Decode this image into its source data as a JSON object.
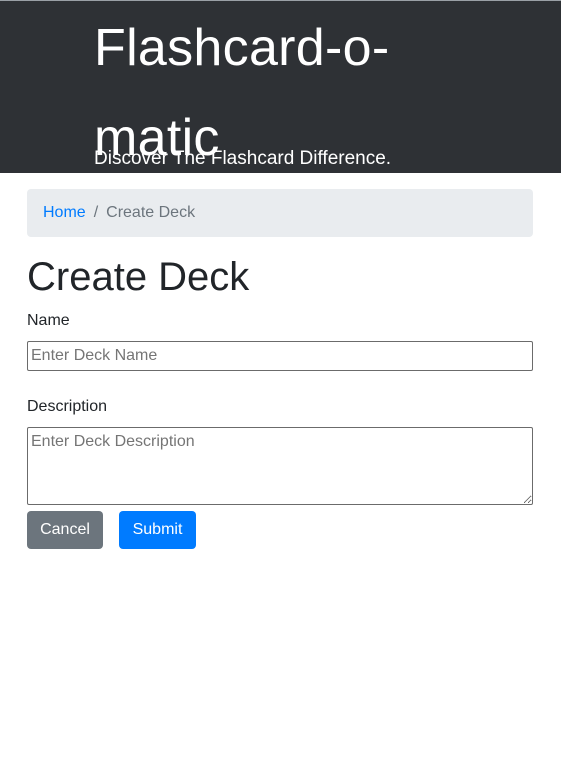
{
  "header": {
    "title": "Flashcard-o-matic",
    "tagline": "Discover The Flashcard Difference."
  },
  "breadcrumb": {
    "home_label": "Home",
    "separator": "/",
    "current_label": "Create Deck"
  },
  "page": {
    "title": "Create Deck"
  },
  "form": {
    "name_label": "Name",
    "name_placeholder": "Enter Deck Name",
    "name_value": "",
    "description_label": "Description",
    "description_placeholder": "Enter Deck Description",
    "description_value": "",
    "cancel_label": "Cancel",
    "submit_label": "Submit"
  },
  "colors": {
    "header_bg": "#2e3135",
    "link": "#007bff",
    "breadcrumb_bg": "#e9ecef",
    "cancel_button": "#6c757d",
    "submit_button": "#007bff"
  }
}
